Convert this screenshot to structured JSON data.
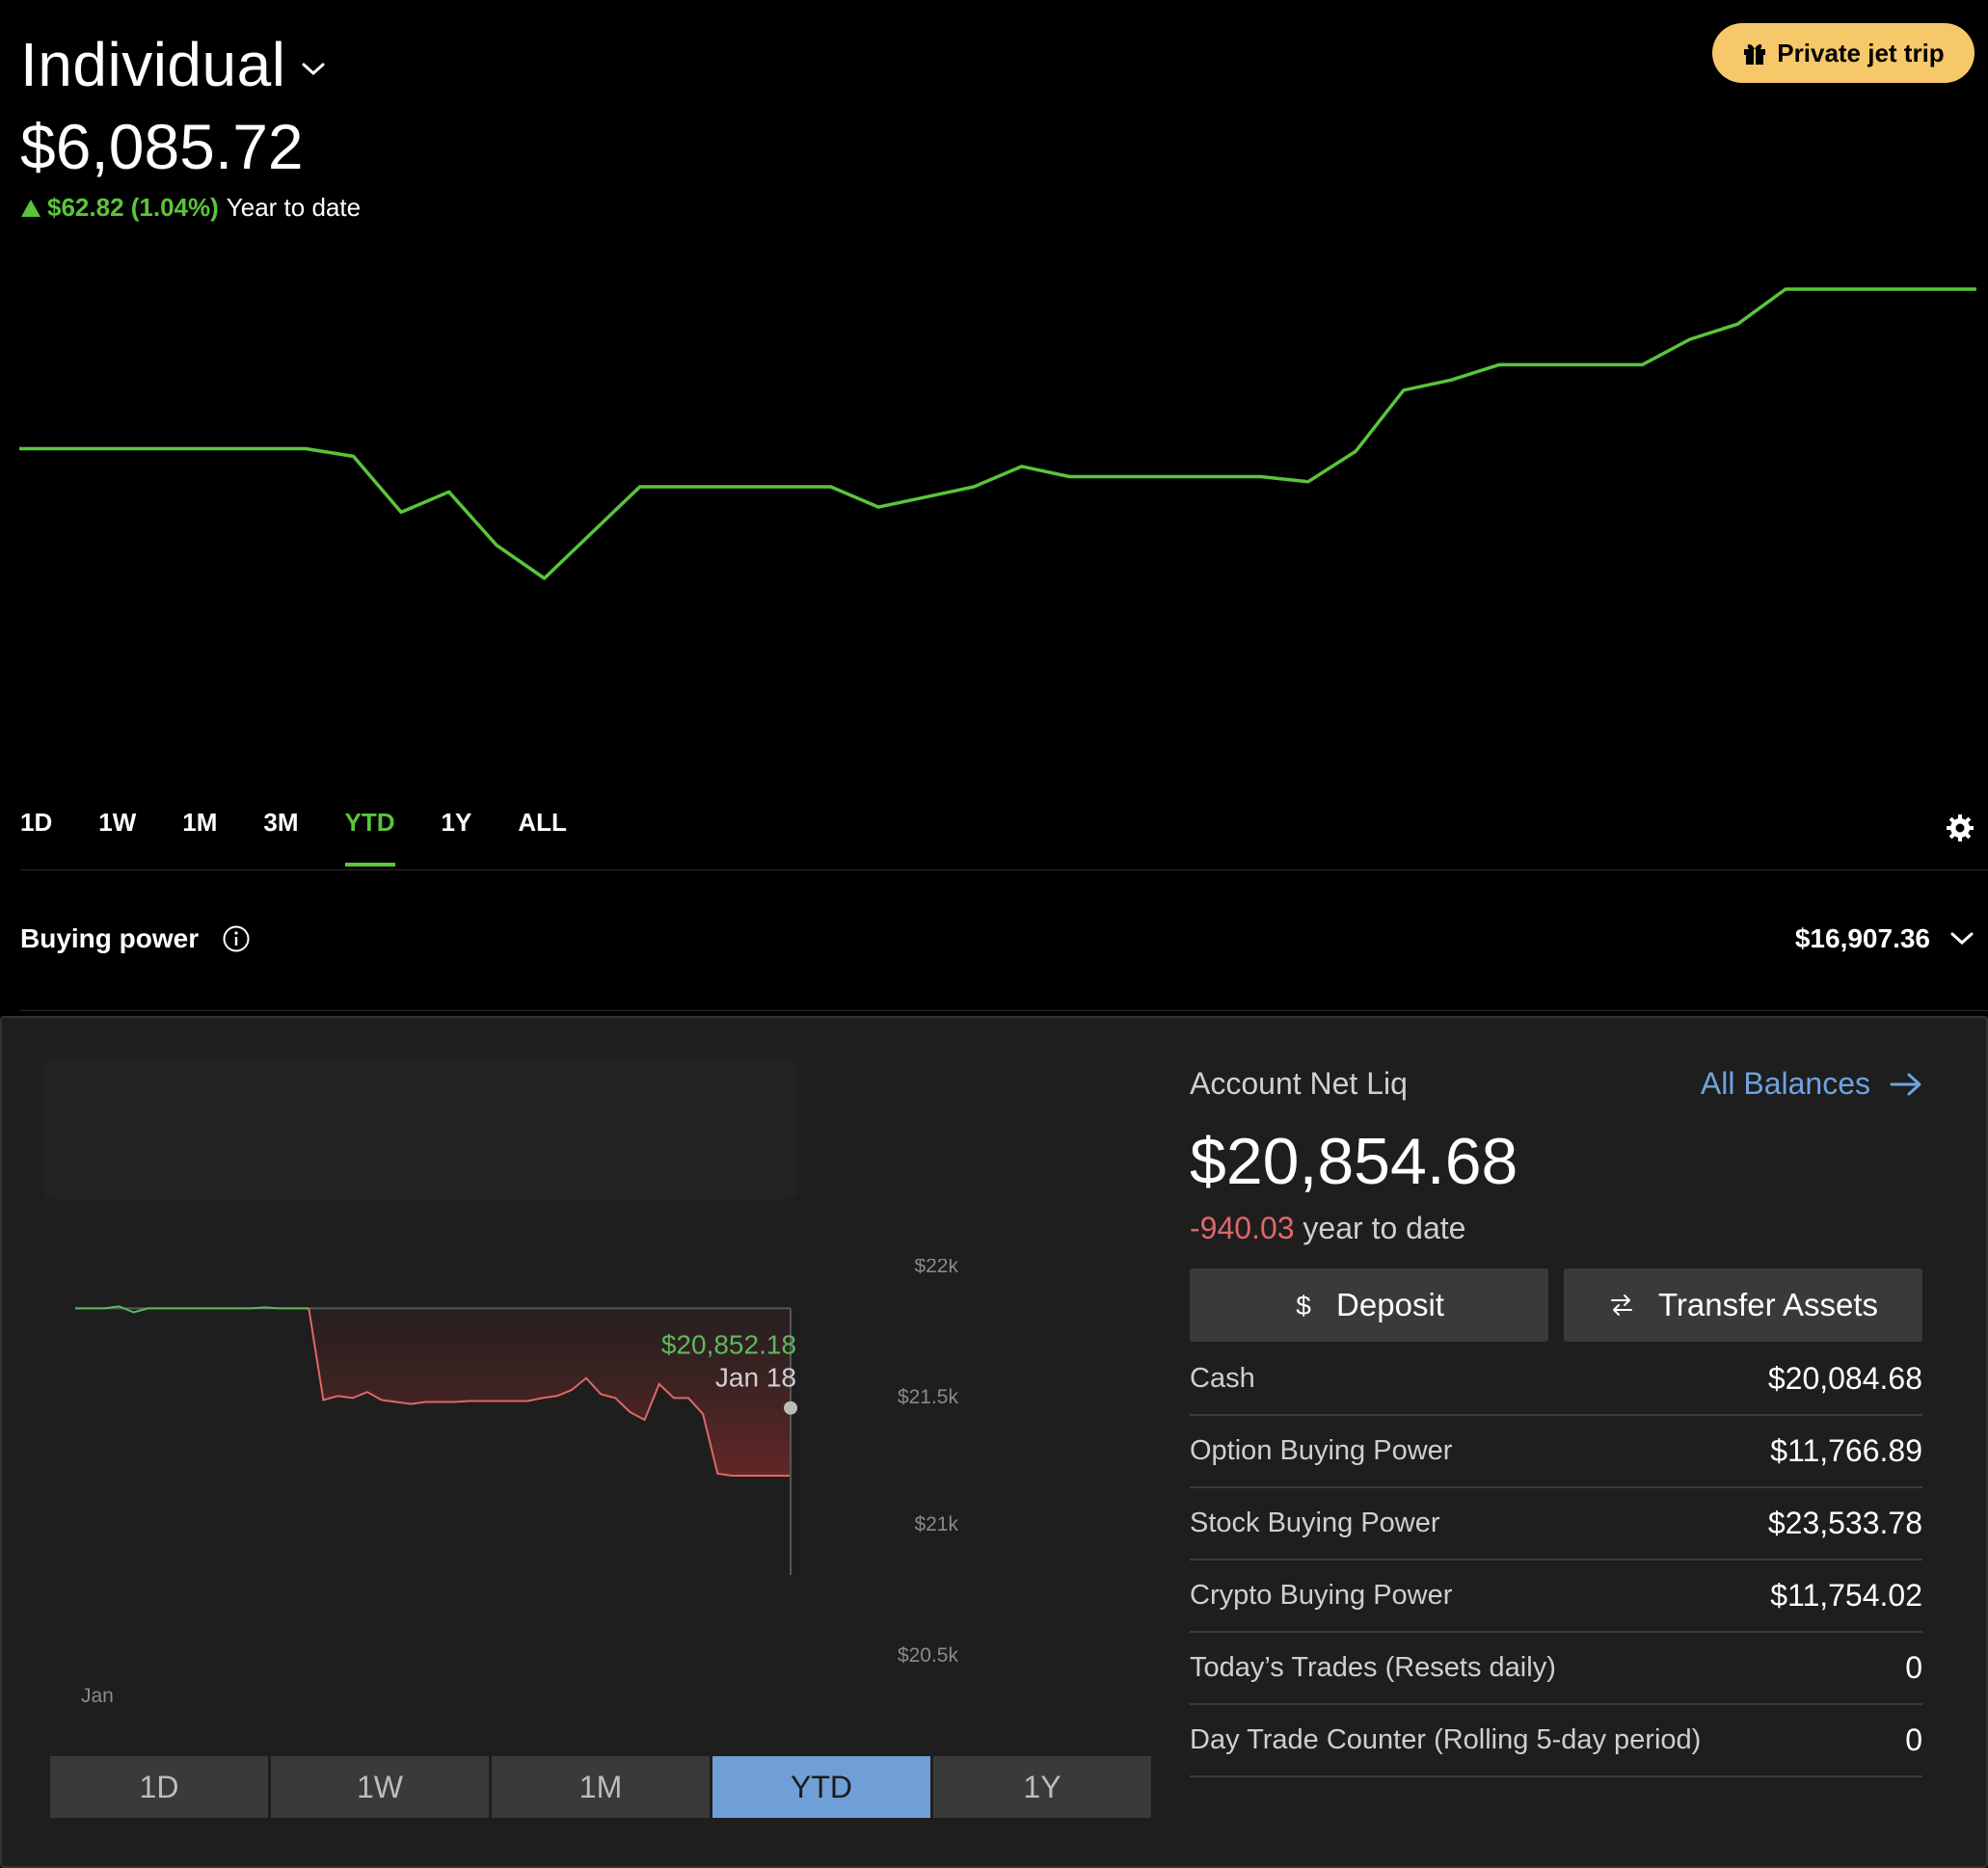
{
  "top": {
    "account_name": "Individual",
    "portfolio_value": "$6,085.72",
    "change_amount": "$62.82 (1.04%)",
    "change_period": "Year to date",
    "promo_label": "Private jet trip",
    "range_tabs": [
      "1D",
      "1W",
      "1M",
      "3M",
      "YTD",
      "1Y",
      "ALL"
    ],
    "active_range": "YTD",
    "buying_power_label": "Buying power",
    "buying_power_value": "$16,907.36",
    "line_color": "#5ac53b",
    "promo_color": "#f6c86a"
  },
  "bottom": {
    "net_liq_label": "Account Net Liq",
    "all_balances_label": "All Balances",
    "net_liq_value": "$20,854.68",
    "ytd_change": "-940.03",
    "ytd_change_label": "year to date",
    "deposit_label": "Deposit",
    "transfer_label": "Transfer Assets",
    "balances": [
      {
        "label": "Cash",
        "value": "$20,084.68"
      },
      {
        "label": "Option Buying Power",
        "value": "$11,766.89"
      },
      {
        "label": "Stock Buying Power",
        "value": "$23,533.78"
      },
      {
        "label": "Crypto Buying Power",
        "value": "$11,754.02"
      },
      {
        "label": "Today’s Trades (Resets daily)",
        "value": "0"
      },
      {
        "label": "Day Trade Counter (Rolling 5-day period)",
        "value": "0"
      }
    ],
    "segment_tabs": [
      "1D",
      "1W",
      "1M",
      "YTD",
      "1Y"
    ],
    "active_segment": "YTD",
    "accent_blue": "#6f9fd6",
    "negative_color": "#e06767"
  },
  "chart_data": [
    {
      "type": "line",
      "title": "",
      "series": [
        {
          "values": [
            6023,
            6023,
            6023,
            6023,
            6023,
            6023,
            6023,
            6020,
            5998,
            6006,
            5985,
            5972,
            5990,
            6008,
            6008,
            6008,
            6008,
            6008,
            6000,
            6004,
            6008,
            6016,
            6012,
            6012,
            6012,
            6012,
            6012,
            6010,
            6022,
            6046,
            6050,
            6056,
            6056,
            6056,
            6056,
            6066,
            6072,
            6085.72,
            6085.72,
            6085.72,
            6085.72,
            6085.72
          ]
        }
      ]
    },
    {
      "type": "area",
      "title": "",
      "x_tick_labels": [
        "Jan"
      ],
      "y_tick_labels": [
        "$22k",
        "$21.5k",
        "$21k",
        "$20.5k"
      ],
      "ylim": [
        20500,
        22000
      ],
      "tooltip": {
        "value": "$20,852.18",
        "date": "Jan 18"
      },
      "baseline": 21790,
      "series": [
        {
          "values": [
            21790,
            21790,
            21790,
            21800,
            21770,
            21790,
            21790,
            21790,
            21790,
            21790,
            21790,
            21790,
            21790,
            21795,
            21790,
            21790,
            21790,
            21330,
            21350,
            21340,
            21370,
            21330,
            21320,
            21310,
            21320,
            21320,
            21320,
            21325,
            21325,
            21325,
            21325,
            21325,
            21340,
            21350,
            21380,
            21440,
            21360,
            21340,
            21270,
            21230,
            21410,
            21340,
            21340,
            21260,
            20960,
            20950,
            20950,
            20950,
            20950,
            20950
          ]
        }
      ]
    }
  ]
}
